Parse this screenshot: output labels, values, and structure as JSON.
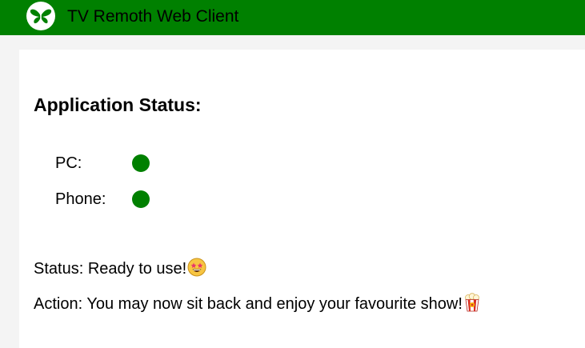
{
  "app": {
    "title": "TV Remoth Web Client",
    "logo_icon": "butterfly-icon"
  },
  "colors": {
    "brand": "#008000",
    "status_ok": "#008000"
  },
  "main": {
    "heading": "Application Status:",
    "devices": [
      {
        "label": "PC:",
        "state": "connected",
        "indicator_icon": "status-dot-icon"
      },
      {
        "label": "Phone:",
        "state": "connected",
        "indicator_icon": "status-dot-icon"
      }
    ],
    "status_label": "Status:",
    "status_text": "Ready to use!",
    "status_emoji": "star-struck-icon",
    "action_label": "Action:",
    "action_text": "You may now sit back and enjoy your favourite show!",
    "action_emoji": "popcorn-icon"
  }
}
